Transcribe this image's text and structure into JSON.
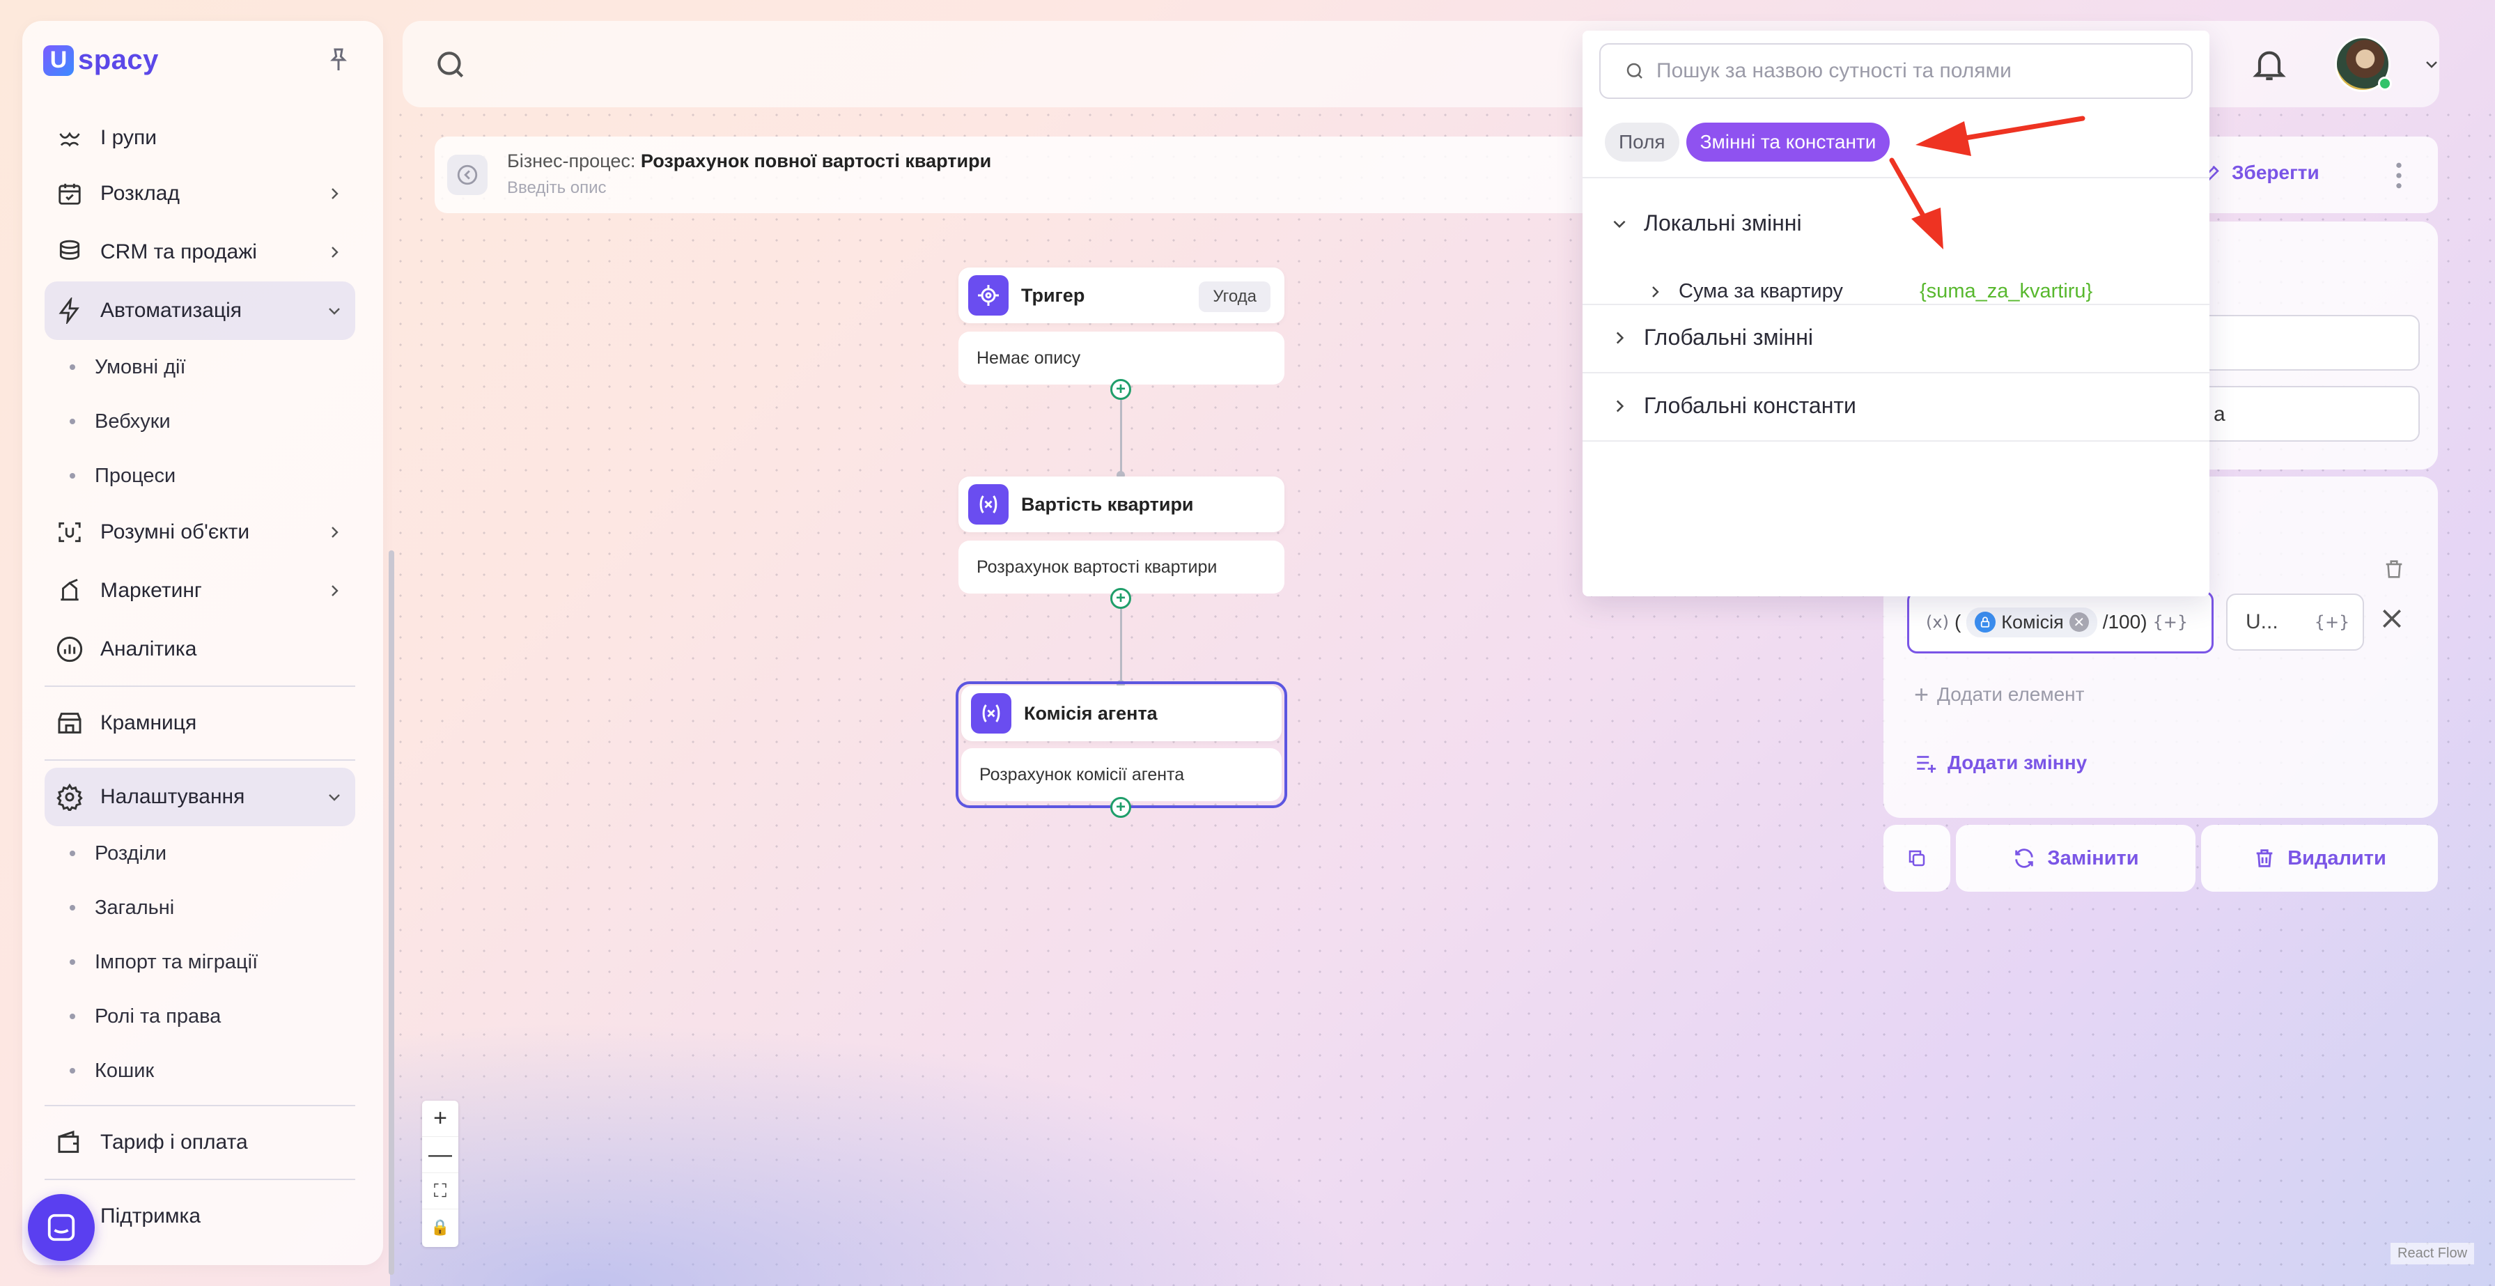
{
  "brand": {
    "logo_letter": "U",
    "logo_text": "spacy"
  },
  "sidebar": {
    "items": [
      {
        "label": "І рупи",
        "icon": "groups-icon"
      },
      {
        "label": "Розклад",
        "icon": "calendar-icon"
      },
      {
        "label": "CRM та продажі",
        "icon": "database-icon"
      },
      {
        "label": "Автоматизація",
        "icon": "lightning-icon"
      },
      {
        "label": "Розумні об'єкти",
        "icon": "smart-object-icon"
      },
      {
        "label": "Маркетинг",
        "icon": "marketing-icon"
      },
      {
        "label": "Аналітика",
        "icon": "analytics-icon"
      },
      {
        "label": "Крамниця",
        "icon": "store-icon"
      },
      {
        "label": "Налаштування",
        "icon": "gear-icon"
      },
      {
        "label": "Тариф і оплата",
        "icon": "wallet-icon"
      },
      {
        "label": "Підтримка",
        "icon": "support-icon"
      }
    ],
    "automation_sub": [
      "Умовні дії",
      "Вебхуки",
      "Процеси"
    ],
    "settings_sub": [
      "Розділи",
      "Загальні",
      "Імпорт та міграції",
      "Ролі та права",
      "Кошик"
    ]
  },
  "process": {
    "label": "Бізнес-процес:",
    "name": "Розрахунок повної вартості квартири",
    "description_placeholder": "Введіть опис",
    "save_label": "Зберегти"
  },
  "nodes": [
    {
      "title": "Тригер",
      "tag": "Угода",
      "description": "Немає опису"
    },
    {
      "title": "Вартість квартири",
      "description": "Розрахунок вартості квартири"
    },
    {
      "title": "Комісія агента",
      "description": "Розрахунок комісії агента"
    }
  ],
  "zoom_controls": {
    "plus": "+",
    "minus": "—",
    "fit": "⛶",
    "lock": "🔒"
  },
  "react_flow_label": "React Flow",
  "right_panel": {
    "partial_text": "а",
    "formula": {
      "fx": "(x)",
      "open_paren": "(",
      "chip": "Комісія",
      "tail": "/100)",
      "plus": "{+}"
    },
    "unit": {
      "value": "U...",
      "plus": "{+}"
    },
    "add_element": "Додати елемент",
    "add_variable": "Додати змінну",
    "replace_label": "Замінити",
    "delete_label": "Видалити"
  },
  "dropdown": {
    "search_placeholder": "Пошук за назвою сутності та полями",
    "tabs": [
      "Поля",
      "Змінні та константи"
    ],
    "groups": [
      "Локальні змінні",
      "Глобальні змінні",
      "Глобальні константи"
    ],
    "local_var": {
      "name": "Сума за квартиру",
      "key": "{suma_za_kvartiru}"
    }
  },
  "colors": {
    "accent": "#7a55e6",
    "tab_active": "#8f52f0",
    "var_green": "#58b82e",
    "arrow_red": "#ee3322"
  }
}
